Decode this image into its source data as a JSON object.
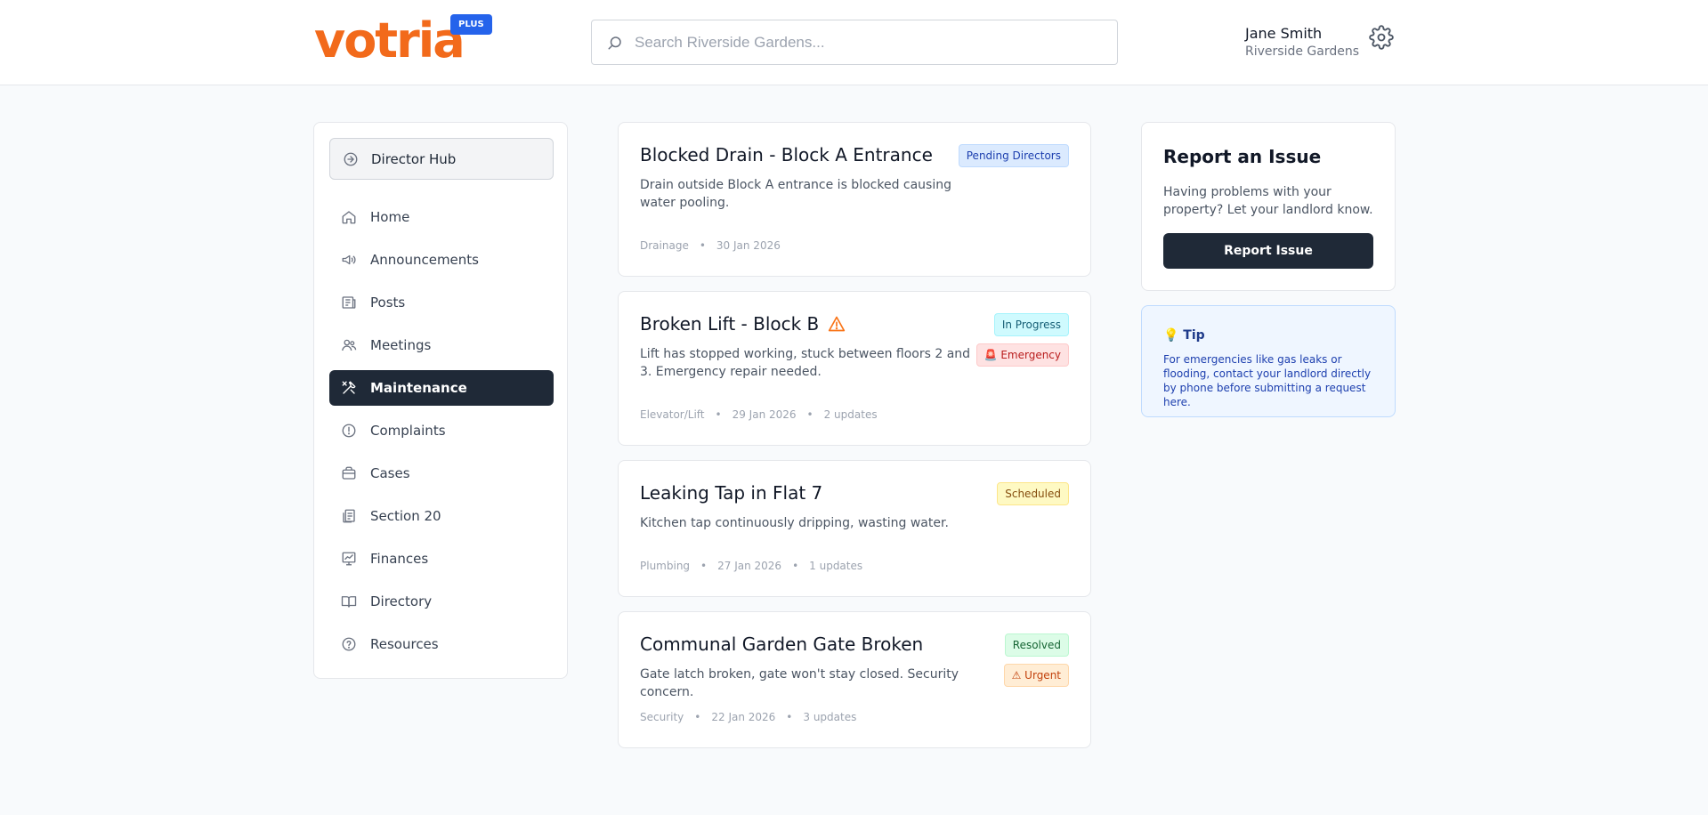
{
  "header": {
    "logo": "votria",
    "plan_badge": "PLUS",
    "search_placeholder": "Search Riverside Gardens...",
    "user_name": "Jane Smith",
    "user_org": "Riverside Gardens"
  },
  "sidebar": {
    "hub_label": "Director Hub",
    "items": [
      {
        "label": "Home",
        "icon": "home-icon"
      },
      {
        "label": "Announcements",
        "icon": "megaphone-icon"
      },
      {
        "label": "Posts",
        "icon": "newspaper-icon"
      },
      {
        "label": "Meetings",
        "icon": "users-icon"
      },
      {
        "label": "Maintenance",
        "icon": "tools-icon",
        "active": true
      },
      {
        "label": "Complaints",
        "icon": "alert-circle-icon"
      },
      {
        "label": "Cases",
        "icon": "briefcase-icon"
      },
      {
        "label": "Section 20",
        "icon": "documents-icon"
      },
      {
        "label": "Finances",
        "icon": "chart-icon"
      },
      {
        "label": "Directory",
        "icon": "book-icon"
      },
      {
        "label": "Resources",
        "icon": "help-circle-icon"
      }
    ]
  },
  "requests": [
    {
      "title": "Blocked Drain - Block A Entrance",
      "description": "Drain outside Block A entrance is blocked causing water pooling.",
      "status": "Pending Directors",
      "category": "Drainage",
      "date": "30 Jan 2026"
    },
    {
      "title": "Broken Lift - Block B",
      "description": "Lift has stopped working, stuck between floors 2 and 3. Emergency repair needed.",
      "status": "In Progress",
      "priority": "🚨 Emergency",
      "category": "Elevator/Lift",
      "date": "29 Jan 2026",
      "updates": "2 updates"
    },
    {
      "title": "Leaking Tap in Flat 7",
      "description": "Kitchen tap continuously dripping, wasting water.",
      "status": "Scheduled",
      "category": "Plumbing",
      "date": "27 Jan 2026",
      "updates": "1 updates"
    },
    {
      "title": "Communal Garden Gate Broken",
      "description": "Gate latch broken, gate won't stay closed. Security concern.",
      "status": "Resolved",
      "priority": "⚠ Urgent",
      "category": "Security",
      "date": "22 Jan 2026",
      "updates": "3 updates"
    }
  ],
  "meta_separator": "•",
  "report": {
    "title": "Report an Issue",
    "text": "Having problems with your property? Let your landlord know.",
    "button": "Report Issue"
  },
  "tip": {
    "title": "💡 Tip",
    "text": "For emergencies like gas leaks or flooding, contact your landlord directly by phone before submitting a request here."
  },
  "colors": {
    "brand": "#f26a1b",
    "accent": "#2563eb",
    "dark": "#1f2937"
  }
}
